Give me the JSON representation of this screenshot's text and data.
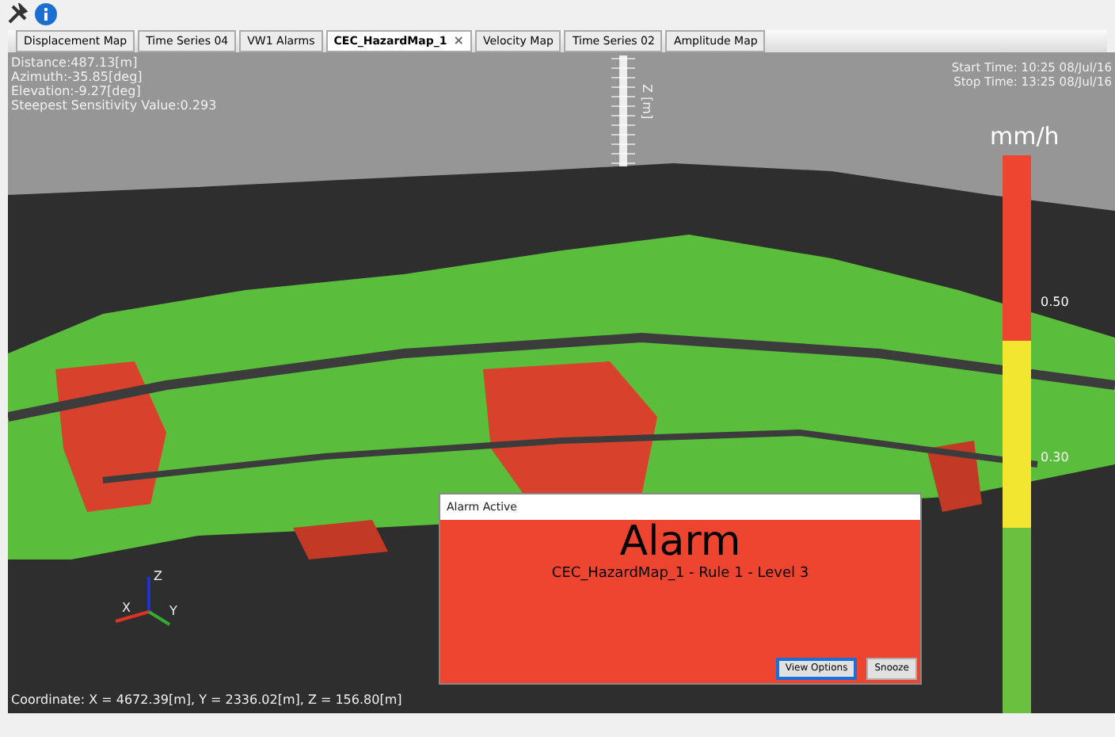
{
  "tabs": [
    {
      "label": "Displacement Map",
      "selected": false
    },
    {
      "label": "Time Series 04",
      "selected": false
    },
    {
      "label": "VW1 Alarms",
      "selected": false
    },
    {
      "label": "CEC_HazardMap_1",
      "selected": true,
      "close": "×"
    },
    {
      "label": "Velocity Map",
      "selected": false
    },
    {
      "label": "Time Series 02",
      "selected": false
    },
    {
      "label": "Amplitude Map",
      "selected": false
    }
  ],
  "view": {
    "info": [
      "Distance:487.13[m]",
      "Azimuth:-35.85[deg]",
      "Elevation:-9.27[deg]",
      "Steepest Sensitivity Value:0.293"
    ],
    "times": [
      "Start Time: 10:25 08/Jul/16",
      "Stop Time: 13:25 08/Jul/16"
    ],
    "z_axis_label": "Z [m]",
    "legend": {
      "unit": "mm/h",
      "segments": [
        {
          "color": "#ee4530"
        },
        {
          "color": "#f2e630"
        },
        {
          "color": "#6cc040"
        }
      ],
      "labels": [
        "0.50",
        "0.30"
      ]
    },
    "triad": {
      "x": "X",
      "y": "Y",
      "z": "Z"
    },
    "coordinate": "Coordinate: X = 4672.39[m], Y = 2336.02[m], Z = 156.80[m]"
  },
  "alarm": {
    "title": "Alarm Active",
    "heading": "Alarm",
    "message": "CEC_HazardMap_1 - Rule 1 - Level 3",
    "buttons": [
      {
        "label": "View Options",
        "selected": true
      },
      {
        "label": "Snooze",
        "selected": false
      }
    ]
  }
}
